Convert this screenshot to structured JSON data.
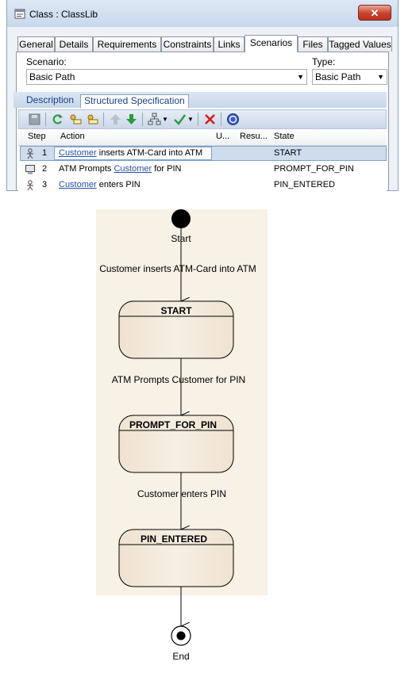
{
  "window": {
    "title": "Class : ClassLib",
    "close_glyph": "✕",
    "tabs": [
      "General",
      "Details",
      "Requirements",
      "Constraints",
      "Links",
      "Scenarios",
      "Files",
      "Tagged Values"
    ],
    "active_tab": "Scenarios"
  },
  "scenario": {
    "label": "Scenario:",
    "value": "Basic Path",
    "type_label": "Type:",
    "type_value": "Basic Path"
  },
  "subtabs": {
    "description": "Description",
    "structured": "Structured Specification",
    "active": "Structured Specification"
  },
  "toolbar": {
    "icons": [
      "save-icon",
      "refresh-icon",
      "insert-step-icon",
      "insert-substep-icon",
      "move-up-icon",
      "move-down-icon",
      "generate-diagram-icon",
      "validate-icon",
      "delete-icon",
      "help-icon"
    ]
  },
  "grid": {
    "columns": [
      "Step",
      "Action",
      "U...",
      "Resu...",
      "State"
    ],
    "rows": [
      {
        "step": "1",
        "actor": "user",
        "link": "Customer",
        "text": " inserts ATM-Card into ATM",
        "state": "START",
        "selected": true
      },
      {
        "step": "2",
        "actor": "system",
        "pre": "ATM Prompts ",
        "link": "Customer",
        "text": " for PIN",
        "state": "PROMPT_FOR_PIN",
        "selected": false
      },
      {
        "step": "3",
        "actor": "user",
        "link": "Customer",
        "text": " enters PIN",
        "state": "PIN_ENTERED",
        "selected": false
      }
    ]
  },
  "diagram": {
    "start_label": "Start",
    "end_label": "End",
    "states": [
      "START",
      "PROMPT_FOR_PIN",
      "PIN_ENTERED"
    ],
    "transitions": [
      "Customer inserts ATM-Card into ATM",
      "ATM Prompts Customer for PIN",
      "Customer enters PIN"
    ],
    "colors": {
      "background": "#f7f1e6",
      "state_fill": "#f1e6d6",
      "stroke": "#000000"
    }
  }
}
